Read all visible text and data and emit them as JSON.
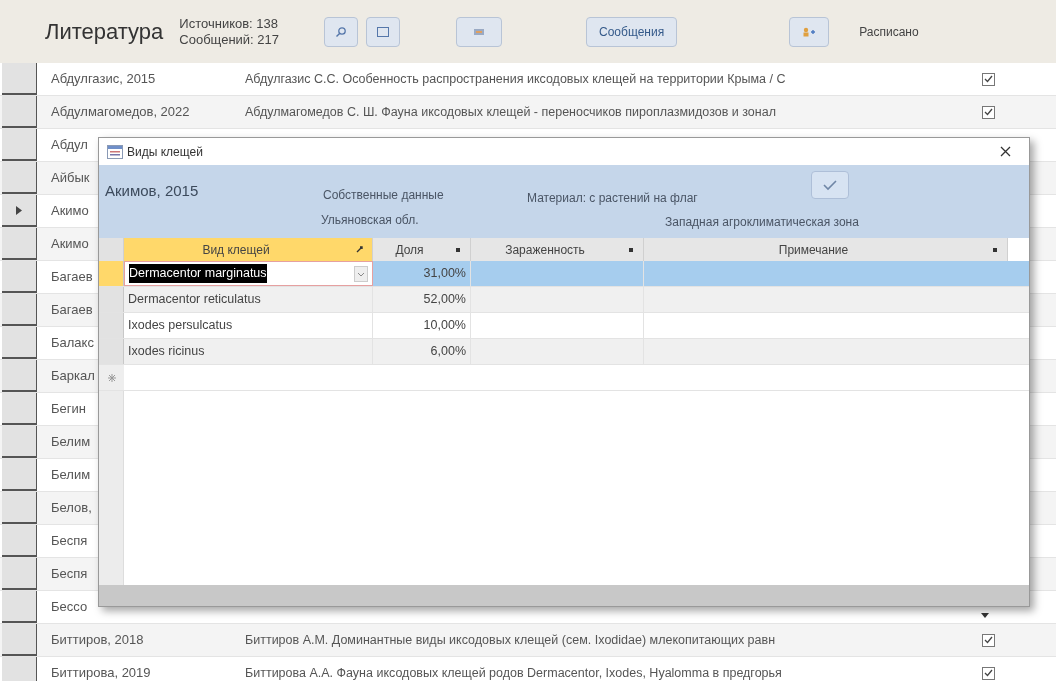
{
  "header": {
    "title": "Литература",
    "sources": "Источников: 138",
    "messages": "Сообщений: 217",
    "messages_button": "Сообщения",
    "status_label": "Расписано"
  },
  "records": [
    {
      "author": "Абдулгазис, 2015",
      "citation": "Абдулгазис С.С. Особенность распространения иксодовых клещей на территории Крыма / С",
      "checked": true,
      "selected": false
    },
    {
      "author": "Абдулмагомедов, 2022",
      "citation": "Абдулмагомедов С. Ш. Фауна иксодовых клещей - переносчиков пироплазмидозов и зонал",
      "checked": true,
      "selected": false
    },
    {
      "author": "Абдул",
      "selected": false
    },
    {
      "author": "Айбык",
      "selected": false
    },
    {
      "author": "Акимо",
      "selected": true
    },
    {
      "author": "Акимо",
      "selected": false
    },
    {
      "author": "Багаев",
      "selected": false
    },
    {
      "author": "Багаев",
      "selected": false
    },
    {
      "author": "Балакс",
      "selected": false
    },
    {
      "author": "Баркал",
      "selected": false
    },
    {
      "author": "Бегин",
      "selected": false
    },
    {
      "author": "Белим",
      "selected": false
    },
    {
      "author": "Белим",
      "selected": false
    },
    {
      "author": "Белов,",
      "selected": false
    },
    {
      "author": "Беспя",
      "selected": false
    },
    {
      "author": "Беспя",
      "selected": false
    },
    {
      "author": "Бессо",
      "selected": false
    },
    {
      "author": "Биттиров, 2018",
      "citation": "Биттиров А.М. Доминантные виды иксодовых клещей (сем. Ixodidae) млекопитающих равн",
      "checked": true,
      "selected": false
    },
    {
      "author": "Биттирова, 2019",
      "citation": "Биттирова А.А. Фауна иксодовых клещей родов Dermacentor, Ixodes, Hyalomma в предгорья",
      "checked": true,
      "selected": false
    }
  ],
  "dialog": {
    "title": "Виды клещей",
    "record": {
      "name": "Акимов, 2015",
      "source": "Собственные данные",
      "region": "Ульяновская обл.",
      "material": "Материал: с растений на флаг",
      "zone": "Западная агроклиматическая зона",
      "confirmed": true
    },
    "columns": [
      {
        "label": "Вид клещей",
        "selected": true
      },
      {
        "label": "Доля",
        "selected": false
      },
      {
        "label": "Зараженность",
        "selected": false
      },
      {
        "label": "Примечание",
        "selected": false
      }
    ],
    "rows": [
      {
        "species": "Dermacentor marginatus",
        "share": "31,00%",
        "selected": true
      },
      {
        "species": "Dermacentor reticulatus",
        "share": "52,00%",
        "selected": false
      },
      {
        "species": "Ixodes persulcatus",
        "share": "10,00%",
        "selected": false
      },
      {
        "species": "Ixodes ricinus",
        "share": "6,00%",
        "selected": false
      }
    ]
  }
}
